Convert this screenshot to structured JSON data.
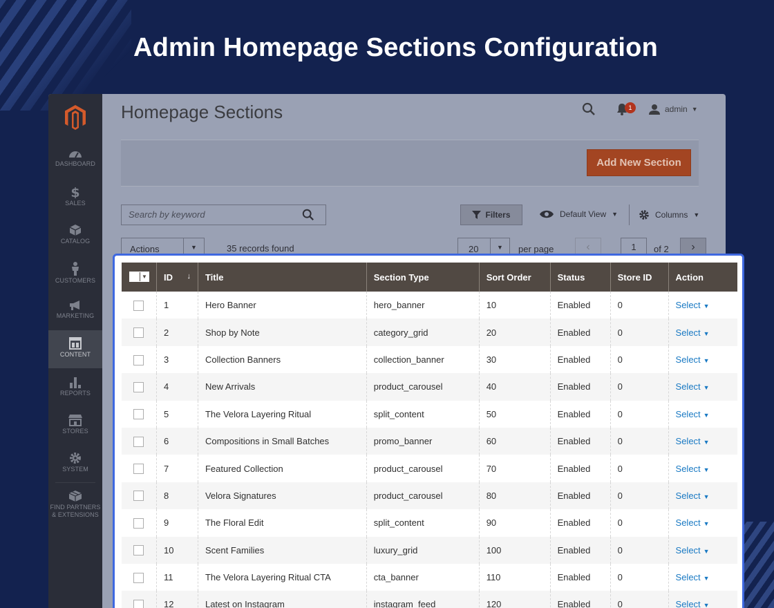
{
  "hero": {
    "title": "Admin Homepage Sections Configuration"
  },
  "sidebar": {
    "logo": "magento-logo",
    "items": [
      {
        "label": "DASHBOARD",
        "icon": "dashboard-icon"
      },
      {
        "label": "SALES",
        "icon": "dollar-icon"
      },
      {
        "label": "CATALOG",
        "icon": "cube-icon"
      },
      {
        "label": "CUSTOMERS",
        "icon": "person-icon"
      },
      {
        "label": "MARKETING",
        "icon": "megaphone-icon"
      },
      {
        "label": "CONTENT",
        "icon": "layout-icon",
        "active": true
      },
      {
        "label": "REPORTS",
        "icon": "bar-chart-icon"
      },
      {
        "label": "STORES",
        "icon": "store-icon"
      },
      {
        "label": "SYSTEM",
        "icon": "gear-icon"
      },
      {
        "label": "FIND PARTNERS & EXTENSIONS",
        "icon": "box-icon"
      }
    ]
  },
  "header": {
    "title": "Homepage Sections",
    "notification_count": "1",
    "user": "admin"
  },
  "toolbar": {
    "add_label": "Add New Section",
    "search_placeholder": "Search by keyword",
    "filters_label": "Filters",
    "view_label": "Default View",
    "columns_label": "Columns",
    "actions_label": "Actions",
    "records": "35 records found",
    "per_page_value": "20",
    "per_page_label": "per page",
    "page": "1",
    "of_pages": "of 2"
  },
  "grid": {
    "columns": [
      "ID",
      "Title",
      "Section Type",
      "Sort Order",
      "Status",
      "Store ID",
      "Action"
    ],
    "sort_arrow": "↓",
    "action_label": "Select",
    "rows": [
      {
        "id": "1",
        "title": "Hero Banner",
        "type": "hero_banner",
        "sort": "10",
        "status": "Enabled",
        "store": "0"
      },
      {
        "id": "2",
        "title": "Shop by Note",
        "type": "category_grid",
        "sort": "20",
        "status": "Enabled",
        "store": "0"
      },
      {
        "id": "3",
        "title": "Collection Banners",
        "type": "collection_banner",
        "sort": "30",
        "status": "Enabled",
        "store": "0"
      },
      {
        "id": "4",
        "title": "New Arrivals",
        "type": "product_carousel",
        "sort": "40",
        "status": "Enabled",
        "store": "0"
      },
      {
        "id": "5",
        "title": "The Velora Layering Ritual",
        "type": "split_content",
        "sort": "50",
        "status": "Enabled",
        "store": "0"
      },
      {
        "id": "6",
        "title": "Compositions in Small Batches",
        "type": "promo_banner",
        "sort": "60",
        "status": "Enabled",
        "store": "0"
      },
      {
        "id": "7",
        "title": "Featured Collection",
        "type": "product_carousel",
        "sort": "70",
        "status": "Enabled",
        "store": "0"
      },
      {
        "id": "8",
        "title": "Velora Signatures",
        "type": "product_carousel",
        "sort": "80",
        "status": "Enabled",
        "store": "0"
      },
      {
        "id": "9",
        "title": "The Floral Edit",
        "type": "split_content",
        "sort": "90",
        "status": "Enabled",
        "store": "0"
      },
      {
        "id": "10",
        "title": "Scent Families",
        "type": "luxury_grid",
        "sort": "100",
        "status": "Enabled",
        "store": "0"
      },
      {
        "id": "11",
        "title": "The Velora Layering Ritual CTA",
        "type": "cta_banner",
        "sort": "110",
        "status": "Enabled",
        "store": "0"
      },
      {
        "id": "12",
        "title": "Latest on Instagram",
        "type": "instagram_feed",
        "sort": "120",
        "status": "Enabled",
        "store": "0"
      }
    ]
  }
}
